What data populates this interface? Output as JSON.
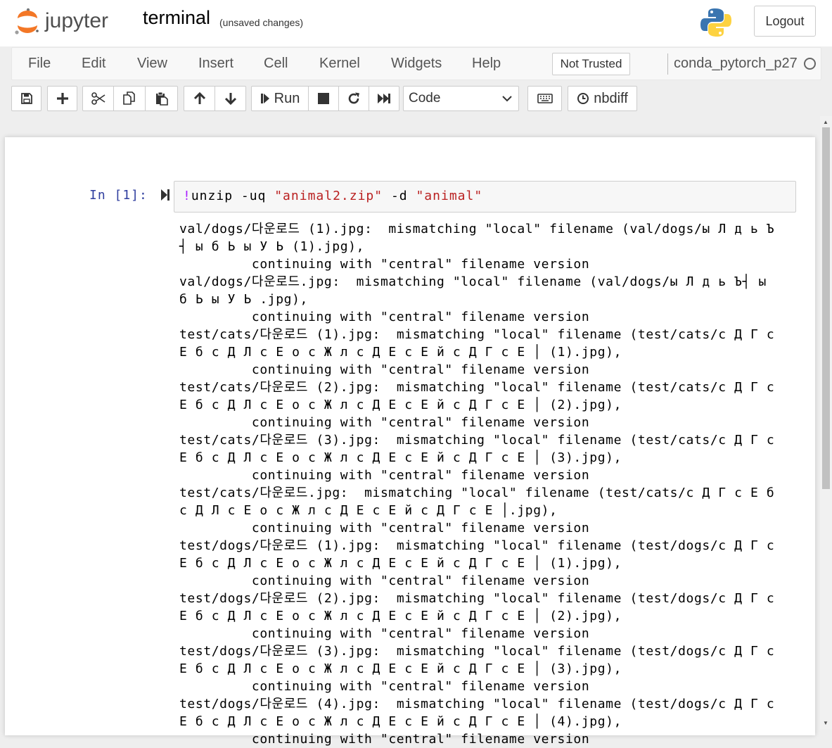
{
  "header": {
    "logo_text": "jupyter",
    "notebook_name": "terminal",
    "save_status": "(unsaved changes)",
    "logout_label": "Logout"
  },
  "menubar": {
    "items": [
      "File",
      "Edit",
      "View",
      "Insert",
      "Cell",
      "Kernel",
      "Widgets",
      "Help"
    ],
    "trust_label": "Not Trusted",
    "kernel_name": "conda_pytorch_p27"
  },
  "toolbar": {
    "run_label": "Run",
    "cell_type": "Code",
    "nbdiff_label": "nbdiff"
  },
  "cell": {
    "prompt": "In [1]:",
    "code_bang": "!",
    "code_cmd1": "unzip -uq ",
    "code_str1": "\"animal2.zip\"",
    "code_cmd2": " -d ",
    "code_str2": "\"animal\"",
    "output_lines": [
      "val/dogs/다운로드 (1).jpg:  mismatching \"local\" filename (val/dogs/ы Л д ь Ъ",
      "┤ ы б Ь ы У Ь (1).jpg),",
      "         continuing with \"central\" filename version",
      "val/dogs/다운로드.jpg:  mismatching \"local\" filename (val/dogs/ы Л д ь Ъ┤ ы",
      "б Ь ы У Ь .jpg),",
      "         continuing with \"central\" filename version",
      "test/cats/다운로드 (1).jpg:  mismatching \"local\" filename (test/cats/с Д Г с",
      "Е б с Д Л с Е о с Ж л с Д Е с Е й с Д Г с Е │ (1).jpg),",
      "         continuing with \"central\" filename version",
      "test/cats/다운로드 (2).jpg:  mismatching \"local\" filename (test/cats/с Д Г с",
      "Е б с Д Л с Е о с Ж л с Д Е с Е й с Д Г с Е │ (2).jpg),",
      "         continuing with \"central\" filename version",
      "test/cats/다운로드 (3).jpg:  mismatching \"local\" filename (test/cats/с Д Г с",
      "Е б с Д Л с Е о с Ж л с Д Е с Е й с Д Г с Е │ (3).jpg),",
      "         continuing with \"central\" filename version",
      "test/cats/다운로드.jpg:  mismatching \"local\" filename (test/cats/с Д Г с Е б",
      "с Д Л с Е о с Ж л с Д Е с Е й с Д Г с Е │.jpg),",
      "         continuing with \"central\" filename version",
      "test/dogs/다운로드 (1).jpg:  mismatching \"local\" filename (test/dogs/с Д Г с",
      "Е б с Д Л с Е о с Ж л с Д Е с Е й с Д Г с Е │ (1).jpg),",
      "         continuing with \"central\" filename version",
      "test/dogs/다운로드 (2).jpg:  mismatching \"local\" filename (test/dogs/с Д Г с",
      "Е б с Д Л с Е о с Ж л с Д Е с Е й с Д Г с Е │ (2).jpg),",
      "         continuing with \"central\" filename version",
      "test/dogs/다운로드 (3).jpg:  mismatching \"local\" filename (test/dogs/с Д Г с",
      "Е б с Д Л с Е о с Ж л с Д Е с Е й с Д Г с Е │ (3).jpg),",
      "         continuing with \"central\" filename version",
      "test/dogs/다운로드 (4).jpg:  mismatching \"local\" filename (test/dogs/с Д Г с",
      "Е б с Д Л с Е о с Ж л с Д Е с Е й с Д Г с Е │ (4).jpg),",
      "         continuing with \"central\" filename version"
    ]
  },
  "icons": {
    "save": "save-icon",
    "insert": "plus-icon",
    "cut": "scissors-icon",
    "copy": "copy-icon",
    "paste": "paste-icon",
    "move_up": "arrow-up-icon",
    "move_down": "arrow-down-icon",
    "run": "step-forward-icon",
    "interrupt": "stop-icon",
    "restart": "redo-icon",
    "restart_run_all": "fast-forward-icon",
    "command_palette": "keyboard-icon",
    "nbdiff": "history-icon"
  },
  "colors": {
    "prompt": "#303f9f",
    "string": "#ba2121",
    "bang": "#aa22ff",
    "jupyter_orange": "#f37726"
  }
}
